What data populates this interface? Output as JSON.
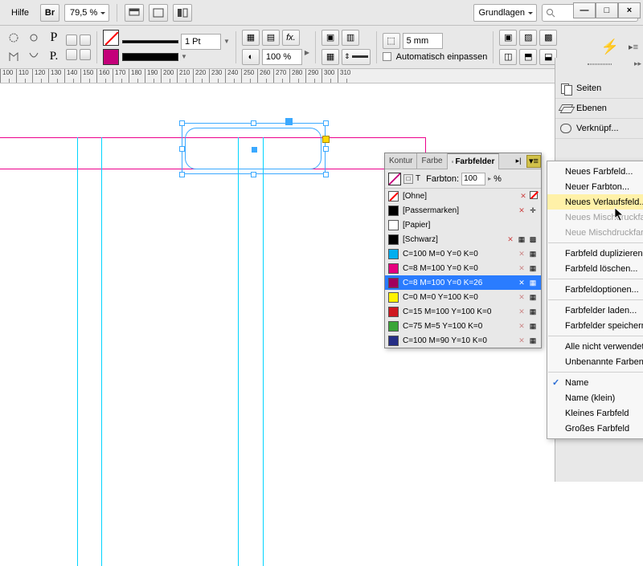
{
  "header": {
    "menu_help": "Hilfe",
    "br": "Br",
    "zoom": "79,5 %",
    "workspace": "Grundlagen"
  },
  "windowbtns": {
    "min": "—",
    "max": "□",
    "close": "×"
  },
  "toolbar": {
    "stroke": "1 Pt",
    "opacity": "100 %",
    "bleed": "5 mm",
    "autofit": "Automatisch einpassen"
  },
  "ruler": [
    "100",
    "110",
    "120",
    "130",
    "140",
    "150",
    "160",
    "170",
    "180",
    "190",
    "200",
    "210",
    "220",
    "230",
    "240",
    "250",
    "260",
    "270",
    "280",
    "290",
    "300",
    "310"
  ],
  "rightpanels": {
    "pages": "Seiten",
    "layers": "Ebenen",
    "links": "Verknüpf..."
  },
  "swatchpanel": {
    "tab_kontur": "Kontur",
    "tab_farbe": "Farbe",
    "tab_felder": "Farbfelder",
    "tone_label": "Farbton:",
    "tone_val": "100",
    "tone_unit": "%",
    "items": [
      {
        "name": "[Ohne]",
        "color": "none"
      },
      {
        "name": "[Passermarken]",
        "color": "#000"
      },
      {
        "name": "[Papier]",
        "color": "#fff"
      },
      {
        "name": "[Schwarz]",
        "color": "#000"
      },
      {
        "name": "C=100 M=0 Y=0 K=0",
        "color": "#00aeef"
      },
      {
        "name": "C=8 M=100 Y=0 K=0",
        "color": "#e5007e"
      },
      {
        "name": "C=8 M=100 Y=0 K=26",
        "color": "#a1005c",
        "sel": true
      },
      {
        "name": "C=0 M=0 Y=100 K=0",
        "color": "#fff200"
      },
      {
        "name": "C=15 M=100 Y=100 K=0",
        "color": "#cf1820"
      },
      {
        "name": "C=75 M=5 Y=100 K=0",
        "color": "#3aa537"
      },
      {
        "name": "C=100 M=90 Y=10 K=0",
        "color": "#262e86"
      }
    ]
  },
  "ctx": [
    {
      "t": "Neues Farbfeld..."
    },
    {
      "t": "Neuer Farbton..."
    },
    {
      "t": "Neues Verlaufsfeld...",
      "hi": true
    },
    {
      "t": "Neues Mischdruckfarben-Feld...",
      "dis": true
    },
    {
      "t": "Neue Mischdruckfarben-Gruppe...",
      "dis": true
    },
    {
      "sep": true
    },
    {
      "t": "Farbfeld duplizieren"
    },
    {
      "t": "Farbfeld löschen..."
    },
    {
      "sep": true
    },
    {
      "t": "Farbfeldoptionen..."
    },
    {
      "sep": true
    },
    {
      "t": "Farbfelder laden..."
    },
    {
      "t": "Farbfelder speichern..."
    },
    {
      "sep": true
    },
    {
      "t": "Alle nicht verwendeten auswählen"
    },
    {
      "t": "Unbenannte Farben hinzufügen"
    },
    {
      "sep": true
    },
    {
      "t": "Name",
      "chk": true
    },
    {
      "t": "Name (klein)"
    },
    {
      "t": "Kleines Farbfeld"
    },
    {
      "t": "Großes Farbfeld"
    }
  ]
}
